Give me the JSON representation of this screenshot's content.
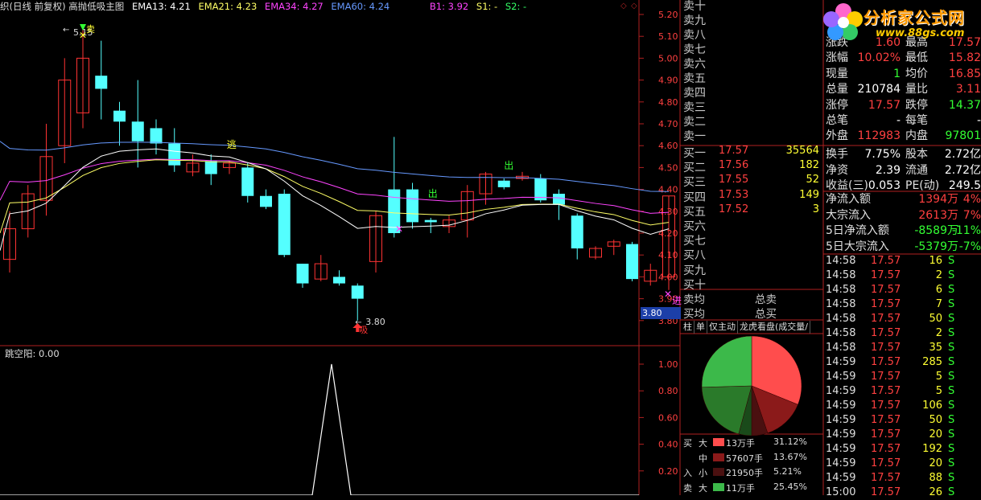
{
  "header": {
    "title": "织(日线 前复权) 高抛低吸主图",
    "ema13": "EMA13: 4.21",
    "ema21": "EMA21: 4.23",
    "ema34": "EMA34: 4.27",
    "ema60": "EMA60: 4.24",
    "b1": "B1: 3.92",
    "s1": "S1: -",
    "s2": "S2: -"
  },
  "indicator": {
    "label": "跳空阳: 0.00",
    "ticks": [
      "1.00",
      "0.80",
      "0.60",
      "0.40",
      "0.20"
    ]
  },
  "price_axis": {
    "ticks": [
      "5.20",
      "5.10",
      "5.00",
      "4.90",
      "4.80",
      "4.70",
      "4.60",
      "4.50",
      "4.40",
      "4.30",
      "4.20",
      "4.10",
      "4.00",
      "3.90",
      "3.80"
    ],
    "current": "3.80"
  },
  "annotations": {
    "high_label": "5.15",
    "low_label": "3.80",
    "sell_mark": "卖",
    "escape_mark": "逃",
    "out_mark_1": "出",
    "out_mark_2": "出",
    "absorb_mark": "吸",
    "enter_mark": "进"
  },
  "orderbook": {
    "sells": [
      "卖十",
      "卖九",
      "卖八",
      "卖七",
      "卖六",
      "卖五",
      "卖四",
      "卖三",
      "卖二",
      "卖一"
    ],
    "buys": [
      {
        "label": "买一",
        "price": "17.57",
        "vol": "35564"
      },
      {
        "label": "买二",
        "price": "17.56",
        "vol": "182"
      },
      {
        "label": "买三",
        "price": "17.55",
        "vol": "52"
      },
      {
        "label": "买四",
        "price": "17.53",
        "vol": "149"
      },
      {
        "label": "买五",
        "price": "17.52",
        "vol": "3"
      },
      {
        "label": "买六",
        "price": "",
        "vol": ""
      },
      {
        "label": "买七",
        "price": "",
        "vol": ""
      },
      {
        "label": "买八",
        "price": "",
        "vol": ""
      },
      {
        "label": "买九",
        "price": "",
        "vol": ""
      },
      {
        "label": "买十",
        "price": "",
        "vol": ""
      }
    ],
    "avg_sell": "卖均",
    "total_sell": "总卖",
    "avg_buy": "买均",
    "total_buy": "总买"
  },
  "tabs": [
    "柱",
    "单",
    "仅主动",
    "龙虎看盘(成交量/"
  ],
  "pie": {
    "legend": [
      {
        "side": "买",
        "size": "大",
        "vol": "13万手",
        "pct": "31.12%",
        "color": "#ff4d4d"
      },
      {
        "side": "",
        "size": "中",
        "vol": "57607手",
        "pct": "13.67%",
        "color": "#8b1a1a"
      },
      {
        "side": "入",
        "size": "小",
        "vol": "21950手",
        "pct": "5.21%",
        "color": "#4a1010"
      },
      {
        "side": "卖",
        "size": "大",
        "vol": "11万手",
        "pct": "25.45%",
        "color": "#3cb94a"
      }
    ]
  },
  "quote": {
    "rows": [
      {
        "l1": "涨跌",
        "v1": "1.60",
        "l2": "最高",
        "v2": "17.57"
      },
      {
        "l1": "涨幅",
        "v1": "10.02%",
        "l2": "最低",
        "v2": "15.82"
      },
      {
        "l1": "现量",
        "v1": "1",
        "l2": "均价",
        "v2": "16.85"
      },
      {
        "l1": "总量",
        "v1": "210784",
        "l2": "量比",
        "v2": "3.11"
      },
      {
        "l1": "涨停",
        "v1": "17.57",
        "l2": "跌停",
        "v2": "14.37"
      },
      {
        "l1": "总笔",
        "v1": "-",
        "l2": "每笔",
        "v2": "-"
      },
      {
        "l1": "外盘",
        "v1": "112983",
        "l2": "内盘",
        "v2": "97801"
      },
      {
        "l1": "换手",
        "v1": "7.75%",
        "l2": "股本",
        "v2": "2.72亿"
      },
      {
        "l1": "净资",
        "v1": "2.39",
        "l2": "流通",
        "v2": "2.72亿"
      },
      {
        "l1": "收益(三)",
        "v1": "0.053",
        "l2": "PE(动)",
        "v2": "249.5"
      }
    ],
    "flows": [
      {
        "label": "净流入额",
        "val": "1394万",
        "pct": "4%"
      },
      {
        "label": "大宗流入",
        "val": "2613万",
        "pct": "7%"
      },
      {
        "label": "5日净流入额",
        "val": "-8589万",
        "pct": "-11%"
      },
      {
        "label": "5日大宗流入",
        "val": "-5379万",
        "pct": "-7%"
      }
    ]
  },
  "ticks": [
    {
      "t": "14:58",
      "p": "17.57",
      "v": "16",
      "s": "S"
    },
    {
      "t": "14:58",
      "p": "17.57",
      "v": "2",
      "s": "S"
    },
    {
      "t": "14:58",
      "p": "17.57",
      "v": "6",
      "s": "S"
    },
    {
      "t": "14:58",
      "p": "17.57",
      "v": "7",
      "s": "S"
    },
    {
      "t": "14:58",
      "p": "17.57",
      "v": "50",
      "s": "S"
    },
    {
      "t": "14:58",
      "p": "17.57",
      "v": "2",
      "s": "S"
    },
    {
      "t": "14:58",
      "p": "17.57",
      "v": "35",
      "s": "S"
    },
    {
      "t": "14:59",
      "p": "17.57",
      "v": "285",
      "s": "S"
    },
    {
      "t": "14:59",
      "p": "17.57",
      "v": "5",
      "s": "S"
    },
    {
      "t": "14:59",
      "p": "17.57",
      "v": "5",
      "s": "S"
    },
    {
      "t": "14:59",
      "p": "17.57",
      "v": "106",
      "s": "S"
    },
    {
      "t": "14:59",
      "p": "17.57",
      "v": "50",
      "s": "S"
    },
    {
      "t": "14:59",
      "p": "17.57",
      "v": "20",
      "s": "S"
    },
    {
      "t": "14:59",
      "p": "17.57",
      "v": "192",
      "s": "S"
    },
    {
      "t": "14:59",
      "p": "17.57",
      "v": "20",
      "s": "S"
    },
    {
      "t": "14:59",
      "p": "17.57",
      "v": "88",
      "s": "S"
    },
    {
      "t": "15:00",
      "p": "17.57",
      "v": "26",
      "s": "S"
    }
  ],
  "logo": {
    "name": "分析家公式网",
    "url": "www.88gs.com"
  },
  "colors": {
    "up": "#ff3333",
    "down": "#54ffff",
    "ema13": "#ffffff",
    "ema21": "#ffff66",
    "ema34": "#ff44ff",
    "ema60": "#6699ff"
  }
}
